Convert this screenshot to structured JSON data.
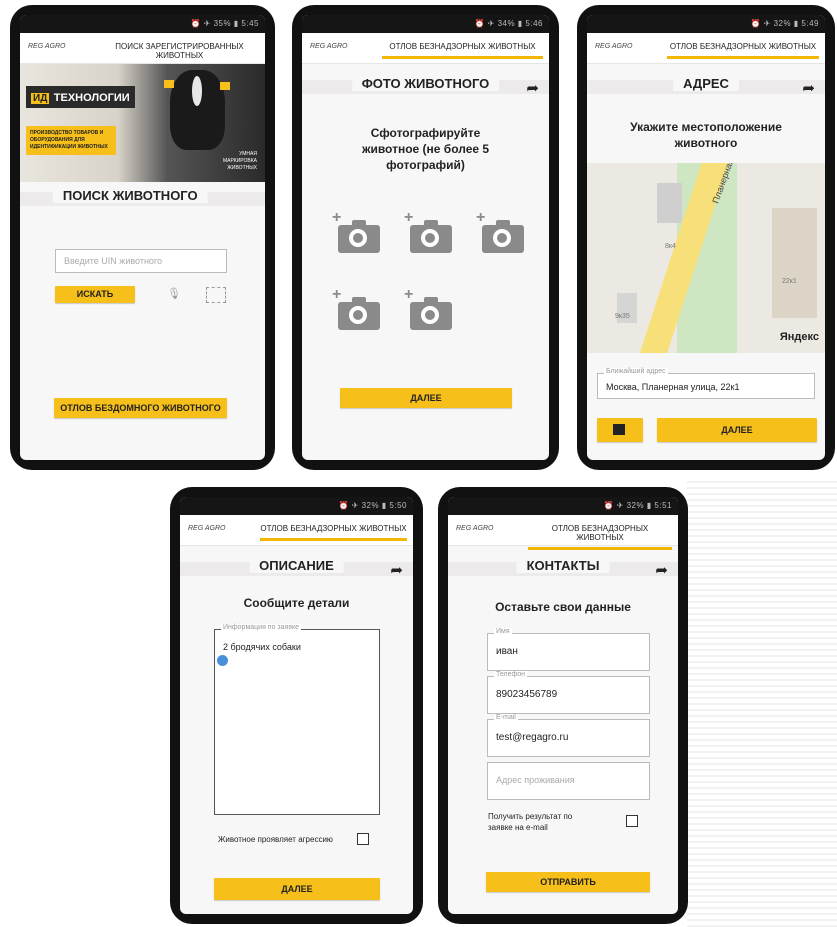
{
  "screens": {
    "search": {
      "status": "⏰ ✈ 35% ▮ 5:45",
      "appbar_title": "ПОИСК ЗАРЕГИСТРИРОВАННЫХ ЖИВОТНЫХ",
      "logo": "REG AGRO",
      "banner": {
        "brand_prefix": "ИД",
        "brand": "ТЕХНОЛОГИИ",
        "promo": "ПРОИЗВОДСТВО ТОВАРОВ И ОБОРУДОВАНИЯ ДЛЯ ИДЕНТИФИКАЦИИ ЖИВОТНЫХ",
        "caption": "УМНАЯ МАРКИРОВКА ЖИВОТНЫХ"
      },
      "section_title": "ПОИСК ЖИВОТНОГО",
      "uin_placeholder": "Введите UIN животного",
      "search_button": "ИСКАТЬ",
      "catch_button": "ОТЛОВ БЕЗДОМНОГО ЖИВОТНОГО"
    },
    "photo": {
      "status": "⏰ ✈ 34% ▮ 5:46",
      "appbar_title": "ОТЛОВ БЕЗНАДЗОРНЫХ ЖИВОТНЫХ",
      "logo": "REG AGRO",
      "section_title": "ФОТО ЖИВОТНОГО",
      "instruction": "Сфотографируйте животное (не более 5 фотографий)",
      "next_button": "ДАЛЕЕ"
    },
    "address": {
      "status": "⏰ ✈ 32% ▮ 5:49",
      "appbar_title": "ОТЛОВ БЕЗНАДЗОРНЫХ ЖИВОТНЫХ",
      "logo": "REG AGRO",
      "section_title": "АДРЕС",
      "instruction": "Укажите местоположение животного",
      "map": {
        "street_label": "Планерная ул.",
        "bldg_1": "8к4",
        "bldg_2": "9к35",
        "bldg_3": "22к1",
        "provider": "Яндекс"
      },
      "address_label": "Ближайший адрес",
      "address_value": "Москва, Планерная улица, 22к1",
      "next_button": "ДАЛЕЕ"
    },
    "description": {
      "status": "⏰ ✈ 32% ▮ 5:50",
      "appbar_title": "ОТЛОВ БЕЗНАДЗОРНЫХ ЖИВОТНЫХ",
      "logo": "REG AGRO",
      "section_title": "ОПИСАНИЕ",
      "instruction": "Сообщите детали",
      "info_label": "Информация по заявке",
      "info_value": "2 бродячих собаки",
      "aggression_label": "Животное проявляет агрессию",
      "next_button": "ДАЛЕЕ"
    },
    "contacts": {
      "status": "⏰ ✈ 32% ▮ 5:51",
      "appbar_title": "ОТЛОВ БЕЗНАДЗОРНЫХ ЖИВОТНЫХ",
      "logo": "REG AGRO",
      "section_title": "КОНТАКТЫ",
      "instruction": "Оставьте свои данные",
      "name_label": "Имя",
      "name_value": "иван",
      "phone_label": "Телефон",
      "phone_value": "89023456789",
      "email_label": "E-mail",
      "email_value": "test@regagro.ru",
      "address_placeholder": "Адрес проживания",
      "email_result_label": "Получить результат по заявке на e-mail",
      "send_button": "ОТПРАВИТЬ"
    }
  },
  "colors": {
    "accent": "#f6bf1a",
    "frame": "#111111",
    "screen_bg": "#f7f7f7"
  }
}
